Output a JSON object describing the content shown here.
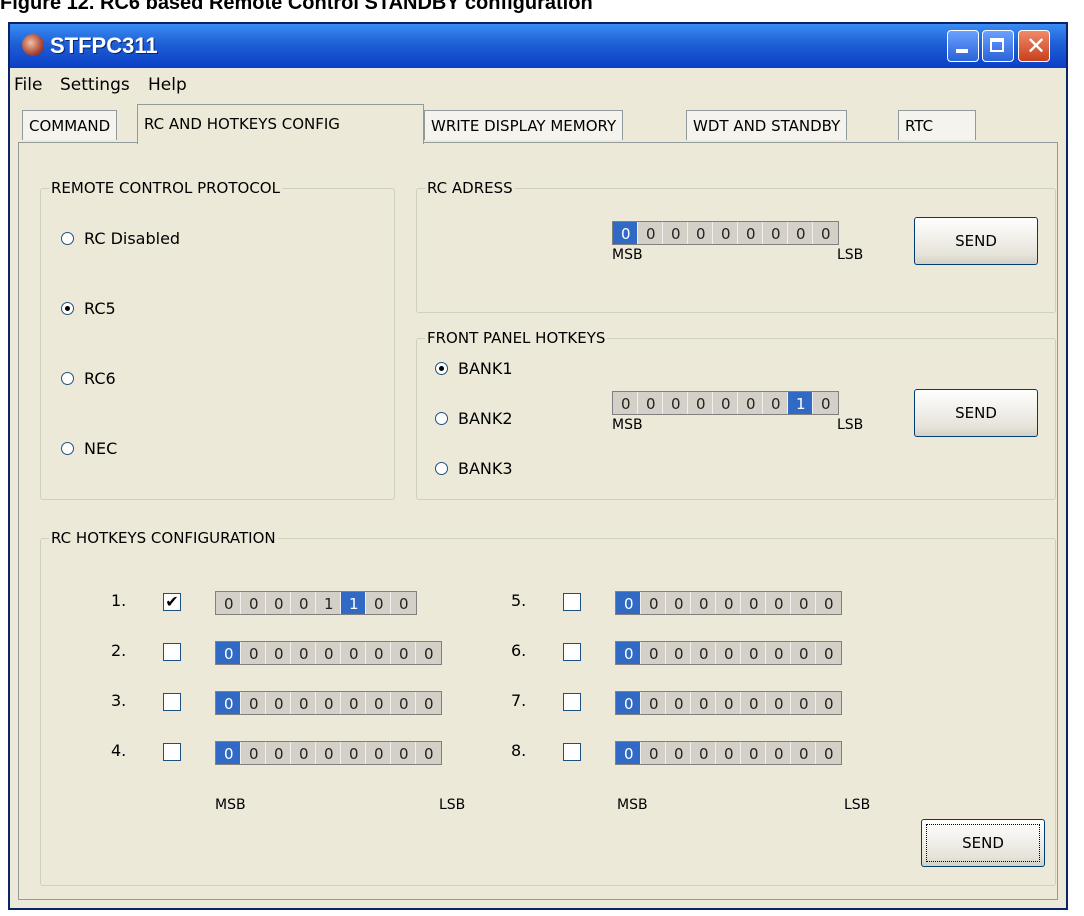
{
  "caption": "Figure 12.  RC6 based Remote Control STANDBY configuration",
  "window": {
    "title": "STFPC311"
  },
  "menu": [
    "File",
    "Settings",
    "Help"
  ],
  "tabs": [
    "COMMAND",
    "RC AND HOTKEYS CONFIG",
    "WRITE DISPLAY MEMORY",
    "WDT AND STANDBY",
    "RTC"
  ],
  "protocol": {
    "title": "REMOTE CONTROL PROTOCOL",
    "options": [
      "RC Disabled",
      "RC5",
      "RC6",
      "NEC"
    ],
    "selected": "RC5"
  },
  "rc_address": {
    "title": "RC ADRESS",
    "bits": [
      "0",
      "0",
      "0",
      "0",
      "0",
      "0",
      "0",
      "0",
      "0"
    ],
    "selected_index": 0,
    "msb": "MSB",
    "lsb": "LSB",
    "send": "SEND"
  },
  "front_panel": {
    "title": "FRONT PANEL HOTKEYS",
    "banks": [
      "BANK1",
      "BANK2",
      "BANK3"
    ],
    "selected": "BANK1",
    "bits": [
      "0",
      "0",
      "0",
      "0",
      "0",
      "0",
      "0",
      "1",
      "0"
    ],
    "selected_index": 7,
    "msb": "MSB",
    "lsb": "LSB",
    "send": "SEND"
  },
  "rc_hotkeys": {
    "title": "RC HOTKEYS CONFIGURATION",
    "rows": [
      {
        "num": "1.",
        "checked": true,
        "bits": [
          "0",
          "0",
          "0",
          "0",
          "1",
          "1",
          "0",
          "0"
        ],
        "sel": 5
      },
      {
        "num": "2.",
        "checked": false,
        "bits": [
          "0",
          "0",
          "0",
          "0",
          "0",
          "0",
          "0",
          "0",
          "0"
        ],
        "sel": 0
      },
      {
        "num": "3.",
        "checked": false,
        "bits": [
          "0",
          "0",
          "0",
          "0",
          "0",
          "0",
          "0",
          "0",
          "0"
        ],
        "sel": 0
      },
      {
        "num": "4.",
        "checked": false,
        "bits": [
          "0",
          "0",
          "0",
          "0",
          "0",
          "0",
          "0",
          "0",
          "0"
        ],
        "sel": 0
      },
      {
        "num": "5.",
        "checked": false,
        "bits": [
          "0",
          "0",
          "0",
          "0",
          "0",
          "0",
          "0",
          "0",
          "0"
        ],
        "sel": 0
      },
      {
        "num": "6.",
        "checked": false,
        "bits": [
          "0",
          "0",
          "0",
          "0",
          "0",
          "0",
          "0",
          "0",
          "0"
        ],
        "sel": 0
      },
      {
        "num": "7.",
        "checked": false,
        "bits": [
          "0",
          "0",
          "0",
          "0",
          "0",
          "0",
          "0",
          "0",
          "0"
        ],
        "sel": 0
      },
      {
        "num": "8.",
        "checked": false,
        "bits": [
          "0",
          "0",
          "0",
          "0",
          "0",
          "0",
          "0",
          "0",
          "0"
        ],
        "sel": 0
      }
    ],
    "msb": "MSB",
    "lsb": "LSB",
    "send": "SEND"
  }
}
